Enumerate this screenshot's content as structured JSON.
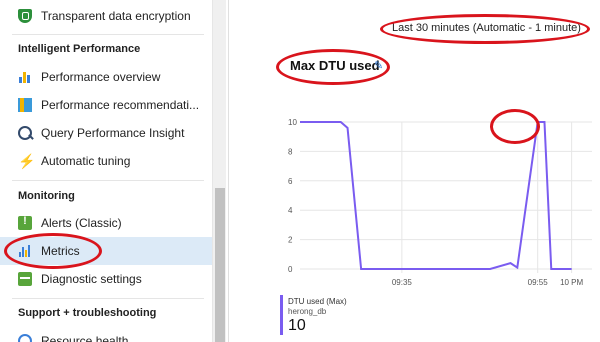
{
  "sidebar": {
    "items_top": [
      {
        "label": "Transparent data encryption",
        "icon": "shield-icon"
      }
    ],
    "sections": [
      {
        "title": "Intelligent Performance"
      },
      {
        "title": "Monitoring"
      },
      {
        "title": "Support + troubleshooting"
      }
    ],
    "intelligent_performance": [
      {
        "label": "Performance overview",
        "icon": "performance-chart-icon"
      },
      {
        "label": "Performance recommendati...",
        "icon": "recommendations-icon"
      },
      {
        "label": "Query Performance Insight",
        "icon": "query-insight-icon"
      },
      {
        "label": "Automatic tuning",
        "icon": "lightning-icon"
      }
    ],
    "monitoring": [
      {
        "label": "Alerts (Classic)",
        "icon": "alert-icon"
      },
      {
        "label": "Metrics",
        "icon": "metrics-icon",
        "selected": true
      },
      {
        "label": "Diagnostic settings",
        "icon": "diagnostic-icon"
      }
    ],
    "support": [
      {
        "label": "Resource health",
        "icon": "heart-icon"
      }
    ]
  },
  "main": {
    "time_range": "Last 30 minutes (Automatic - 1 minute)",
    "chart_title": "Max DTU used"
  },
  "chart_data": {
    "type": "line",
    "title": "Max DTU used",
    "x_tick_labels": [
      "09:35",
      "09:55",
      "10 PM"
    ],
    "y_tick_labels": [
      "10",
      "8",
      "6",
      "4",
      "2",
      "0"
    ],
    "ylim": [
      0,
      10
    ],
    "grid": true,
    "series": [
      {
        "name": "DTU used (Max)",
        "color": "#7a5cf0",
        "points": [
          {
            "x": "09:20",
            "y": 10
          },
          {
            "x": "09:26",
            "y": 10
          },
          {
            "x": "09:27",
            "y": 9.6
          },
          {
            "x": "09:29",
            "y": 0
          },
          {
            "x": "09:48",
            "y": 0
          },
          {
            "x": "09:51",
            "y": 0.4
          },
          {
            "x": "09:52",
            "y": 0.1
          },
          {
            "x": "09:55",
            "y": 10
          },
          {
            "x": "09:56",
            "y": 10
          },
          {
            "x": "09:57",
            "y": 0
          },
          {
            "x": "10:00",
            "y": 0
          }
        ]
      }
    ],
    "legend": {
      "name": "DTU used (Max)",
      "resource": "herong_db",
      "value": "10"
    }
  }
}
